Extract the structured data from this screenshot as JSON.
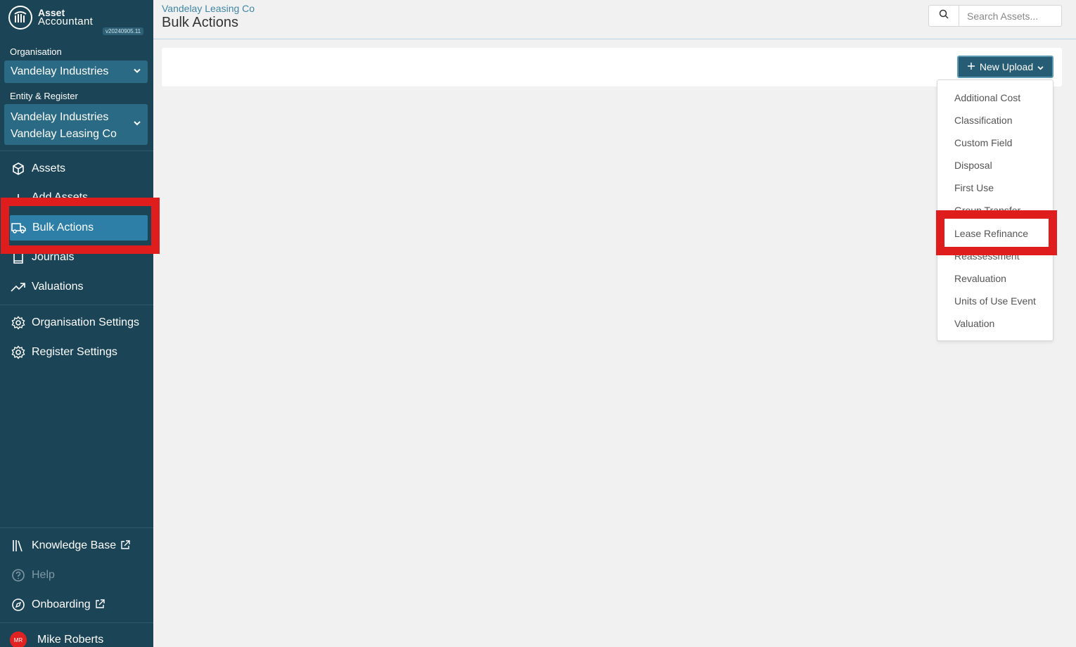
{
  "brand": {
    "line1": "Asset",
    "line2": "Accountant",
    "version": "v20240905.11"
  },
  "sidebar": {
    "org_label": "Organisation",
    "org_value": "Vandelay Industries",
    "entity_label": "Entity & Register",
    "entity_line1": "Vandelay Industries",
    "entity_line2": "Vandelay Leasing Co",
    "items": [
      {
        "label": "Assets",
        "icon": "box-icon"
      },
      {
        "label": "Add Assets",
        "icon": "plus-icon"
      },
      {
        "label": "Bulk Actions",
        "icon": "truck-icon",
        "active": true
      },
      {
        "label": "Journals",
        "icon": "book-icon"
      },
      {
        "label": "Valuations",
        "icon": "trend-up-icon"
      },
      {
        "label": "Organisation Settings",
        "icon": "gear-icon"
      },
      {
        "label": "Register Settings",
        "icon": "gear-icon"
      }
    ],
    "bottom_items": [
      {
        "label": "Knowledge Base",
        "icon": "library-icon",
        "external": true
      },
      {
        "label": "Help",
        "icon": "help-icon",
        "disabled": true
      },
      {
        "label": "Onboarding",
        "icon": "compass-icon",
        "external": true
      }
    ],
    "user": {
      "initials": "MR",
      "name": "Mike Roberts"
    }
  },
  "header": {
    "breadcrumb": "Vandelay Leasing Co",
    "title": "Bulk Actions",
    "search_placeholder": "Search Assets..."
  },
  "toolbar": {
    "new_upload_label": "New Upload"
  },
  "dropdown": {
    "items": [
      "Additional Cost",
      "Classification",
      "Custom Field",
      "Disposal",
      "First Use",
      "Group Transfer",
      "Lease Refinance",
      "Reassessment",
      "Revaluation",
      "Units of Use Event",
      "Valuation"
    ]
  },
  "colors": {
    "sidebar_bg": "#1b4456",
    "accent": "#2d7fa8",
    "highlight": "#e01d1d"
  }
}
